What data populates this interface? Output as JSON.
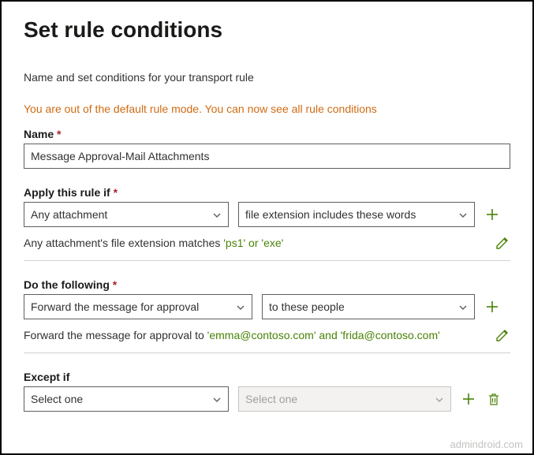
{
  "header": {
    "title": "Set rule conditions",
    "subtitle": "Name and set conditions for your transport rule",
    "warning": "You are out of the default rule mode. You can now see all rule conditions"
  },
  "name_field": {
    "label": "Name",
    "value": "Message Approval-Mail Attachments"
  },
  "apply_if": {
    "label": "Apply this rule if",
    "left_select": "Any attachment",
    "right_select": "file extension includes these words",
    "summary_prefix": "Any attachment's file extension matches ",
    "summary_value": "'ps1' or 'exe'"
  },
  "do_following": {
    "label": "Do the following",
    "left_select": "Forward the message for approval",
    "right_select": "to these people",
    "summary_prefix": "Forward the message for approval to ",
    "summary_value": "'emma@contoso.com' and 'frida@contoso.com'"
  },
  "except_if": {
    "label": "Except if",
    "left_select": "Select one",
    "right_select": "Select one"
  },
  "watermark": "admindroid.com"
}
